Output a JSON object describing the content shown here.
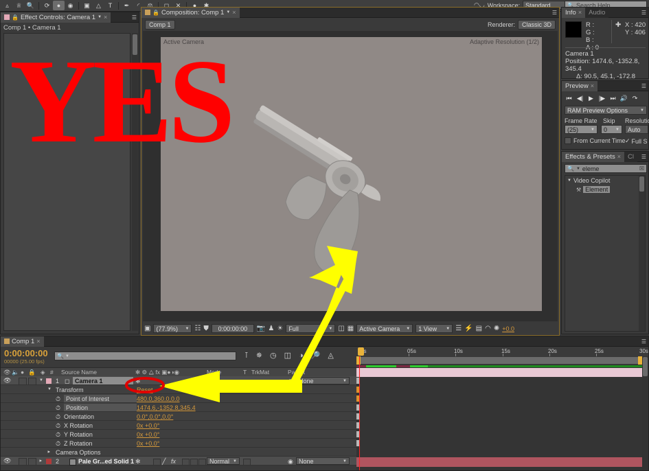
{
  "toolbar": {
    "workspace_label": "Workspace:",
    "workspace_value": "Standard",
    "search_placeholder": "Search Help",
    "tools": [
      "selection-tool",
      "hand-tool",
      "zoom-tool",
      "rotation-tool",
      "unified-camera-tool",
      "orbit-camera-tool",
      "pan-behind-tool",
      "mask-shape-tool",
      "pen-tool",
      "type-tool",
      "brush-tool",
      "clone-stamp-tool",
      "eraser-tool",
      "roto-brush-tool",
      "puppet-pin-tool"
    ]
  },
  "effect_controls": {
    "tab_title": "Effect Controls: Camera 1",
    "breadcrumb": "Comp 1 • Camera 1"
  },
  "composition": {
    "tab_title": "Composition: Comp 1",
    "comp_button": "Comp 1",
    "renderer_label": "Renderer:",
    "renderer_value": "Classic 3D",
    "view_label_left": "Active Camera",
    "view_label_right": "Adaptive Resolution (1/2)",
    "bottom": {
      "zoom": "(77.9%)",
      "timecode": "0:00:00:00",
      "resolution": "Full",
      "camera_view": "Active Camera",
      "view_count": "1 View",
      "exposure": "+0.0"
    }
  },
  "info_panel": {
    "tab_title": "Info",
    "tab_title_2": "Audio",
    "r_label": "R :",
    "g_label": "G :",
    "b_label": "B :",
    "a_label": "A : 0",
    "x_value": "X : 420",
    "y_value": "Y : 406",
    "layer_name": "Camera 1",
    "position_line": "Position: 1474.6, -1352.8, 345.4",
    "delta_line": "Δ: 90.5, 45.1, -172.8"
  },
  "preview_panel": {
    "tab_title": "Preview",
    "ram_preview_options": "RAM Preview Options",
    "frame_rate_label": "Frame Rate",
    "frame_rate_value": "(25)",
    "skip_label": "Skip",
    "skip_value": "0",
    "resolution_label": "Resolutio",
    "resolution_value": "Auto",
    "from_current_time": "From Current Time",
    "full_screen": "Full S",
    "transport": [
      "first-frame-icon",
      "prev-frame-icon",
      "play-icon",
      "next-frame-icon",
      "last-frame-icon",
      "audio-icon",
      "loop-icon"
    ]
  },
  "effects_presets": {
    "tab_title": "Effects & Presets",
    "tab_title_2": "Cl",
    "search_value": "eleme",
    "group": "Video Copilot",
    "item": "Element"
  },
  "timeline": {
    "tab_title": "Comp 1",
    "timecode": "0:00:00:00",
    "frames": "00000 (25.00 fps)",
    "columns": {
      "source_name": "Source Name",
      "mode": "Mode",
      "t": "T",
      "trkmat": "TrkMat",
      "parent": "Parent"
    },
    "ruler_ticks": [
      "0s",
      "05s",
      "10s",
      "15s",
      "20s",
      "25s",
      "30s"
    ],
    "rows": [
      {
        "index": "1",
        "name": "Camera 1",
        "kind": "layer",
        "parent": "None"
      },
      {
        "index": "",
        "name": "Transform",
        "kind": "group",
        "value": "Reset"
      },
      {
        "index": "",
        "name": "Point of Interest",
        "kind": "prop",
        "value": "480.0,360.0,0.0"
      },
      {
        "index": "",
        "name": "Position",
        "kind": "prop",
        "value": "1474.6,-1352.8,345.4"
      },
      {
        "index": "",
        "name": "Orientation",
        "kind": "prop",
        "value": "0.0°,0.0°,0.0°"
      },
      {
        "index": "",
        "name": "X Rotation",
        "kind": "prop",
        "value": "0x +0.0°"
      },
      {
        "index": "",
        "name": "Y Rotation",
        "kind": "prop",
        "value": "0x +0.0°"
      },
      {
        "index": "",
        "name": "Z Rotation",
        "kind": "prop",
        "value": "0x +0.0°"
      },
      {
        "index": "",
        "name": "Camera Options",
        "kind": "group",
        "value": ""
      },
      {
        "index": "2",
        "name": "Pale Gr...ed Solid 1",
        "kind": "layer",
        "mode": "Normal",
        "parent": "None"
      }
    ]
  },
  "annotations": {
    "yes_text": "YES",
    "yes_color": "#ff0000",
    "arrow_color": "#ffff00",
    "circle_color": "#e00000"
  }
}
